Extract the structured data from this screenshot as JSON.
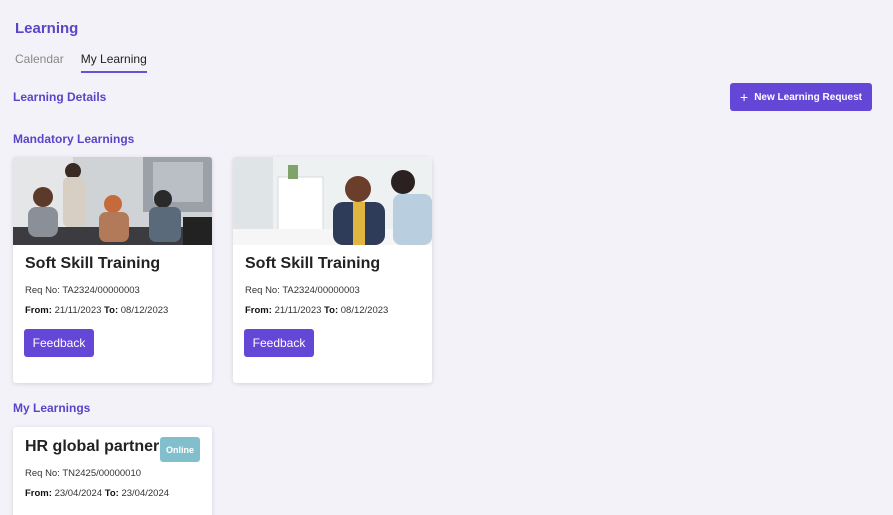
{
  "page": {
    "title": "Learning"
  },
  "tabs": [
    {
      "label": "Calendar",
      "active": false
    },
    {
      "label": "My Learning",
      "active": true
    }
  ],
  "sections": {
    "details_label": "Learning Details",
    "mandatory_label": "Mandatory Learnings",
    "my_label": "My Learnings"
  },
  "actions": {
    "new_request_label": "New Learning Request",
    "new_request_icon": "plus-icon"
  },
  "mandatory": [
    {
      "title": "Soft Skill Training",
      "req_label": "Req No:",
      "req_no": "TA2324/00000003",
      "from_label": "From:",
      "from": "21/11/2023",
      "to_label": "To:",
      "to": "08/12/2023",
      "button": "Feedback"
    },
    {
      "title": "Soft Skill Training",
      "req_label": "Req No:",
      "req_no": "TA2324/00000003",
      "from_label": "From:",
      "from": "21/11/2023",
      "to_label": "To:",
      "to": "08/12/2023",
      "button": "Feedback"
    }
  ],
  "my_learnings": [
    {
      "title": "HR global partner",
      "badge": "Online",
      "req_label": "Req No:",
      "req_no": "TN2425/00000010",
      "from_label": "From:",
      "from": "23/04/2024",
      "to_label": "To:",
      "to": "23/04/2024"
    }
  ],
  "colors": {
    "accent": "#6447d6",
    "heading": "#5a45c9",
    "badge": "#82bfcd",
    "background": "#f3f2f8"
  }
}
